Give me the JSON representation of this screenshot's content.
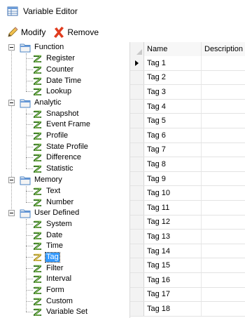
{
  "window": {
    "title": "Variable Editor"
  },
  "toolbar": {
    "modify_label": "Modify",
    "remove_label": "Remove"
  },
  "tree": {
    "groups": [
      {
        "label": "Function",
        "expanded": true,
        "items": [
          "Register",
          "Counter",
          "Date Time",
          "Lookup"
        ]
      },
      {
        "label": "Analytic",
        "expanded": true,
        "items": [
          "Snapshot",
          "Event Frame",
          "Profile",
          "State Profile",
          "Difference",
          "Statistic"
        ]
      },
      {
        "label": "Memory",
        "expanded": true,
        "items": [
          "Text",
          "Number"
        ]
      },
      {
        "label": "User Defined",
        "expanded": true,
        "items": [
          "System",
          "Date",
          "Time",
          "Tag",
          "Filter",
          "Interval",
          "Form",
          "Custom",
          "Variable Set"
        ]
      }
    ],
    "selected": "Tag"
  },
  "grid": {
    "columns": [
      "Name",
      "Description"
    ],
    "rows": [
      "Tag 1",
      "Tag 2",
      "Tag 3",
      "Tag 4",
      "Tag 5",
      "Tag 6",
      "Tag 7",
      "Tag 8",
      "Tag 9",
      "Tag 10",
      "Tag 11",
      "Tag 12",
      "Tag 13",
      "Tag 14",
      "Tag 15",
      "Tag 16",
      "Tag 17",
      "Tag 18"
    ],
    "current_row": 0
  },
  "colors": {
    "selection": "#3399ff",
    "remove_icon": "#e03c1f",
    "folder": "#4a83c4",
    "variable_icon": "#2d6a1e"
  },
  "icons": {
    "app": "table-icon",
    "modify": "pencil-icon",
    "remove": "x-icon",
    "group": "folder-icon",
    "item": "variable-icon"
  }
}
